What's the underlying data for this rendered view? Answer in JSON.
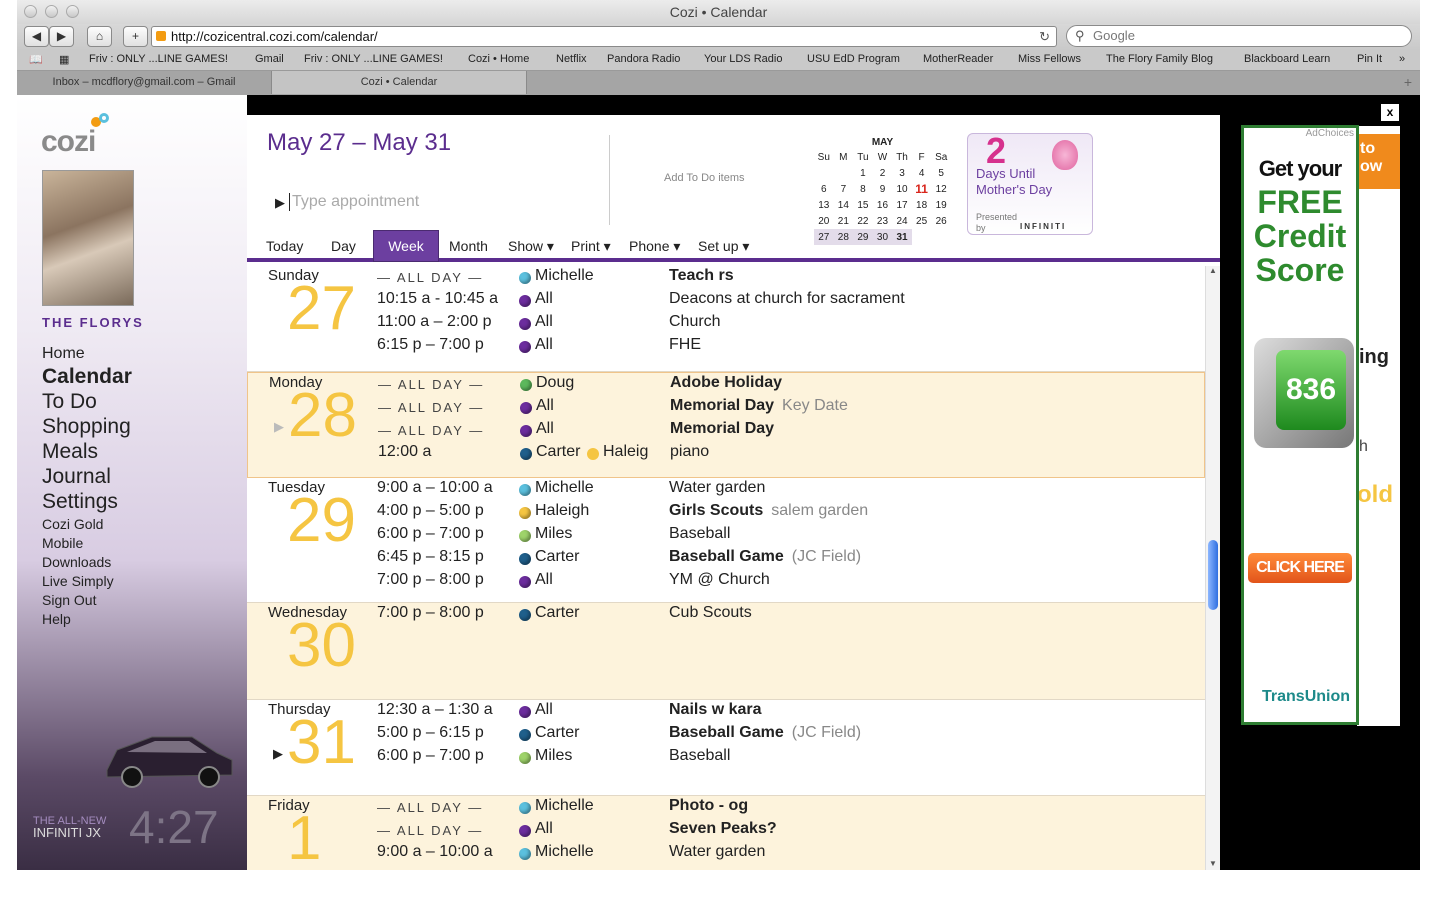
{
  "browser": {
    "title": "Cozi • Calendar",
    "url": "http://cozicentral.cozi.com/calendar/",
    "search_placeholder": "Google",
    "bookmarks": [
      "Friv : ONLY ...LINE GAMES!",
      "Gmail",
      "Friv : ONLY ...LINE GAMES!",
      "Cozi • Home",
      "Netflix",
      "Pandora Radio",
      "Your LDS Radio",
      "USU EdD Program",
      "MotherReader",
      "Miss Fellows",
      "The Flory Family Blog",
      "Blackboard Learn",
      "Pin It"
    ],
    "tabs": [
      "Inbox – mcdflory@gmail.com – Gmail",
      "Cozi • Calendar"
    ]
  },
  "sidebar": {
    "logo": "cozi",
    "family": "THE FLORYS",
    "nav_main": [
      "Home",
      "Calendar",
      "To Do",
      "Shopping",
      "Meals",
      "Journal",
      "Settings"
    ],
    "nav_small": [
      "Cozi Gold",
      "Mobile",
      "Downloads",
      "Live Simply",
      "Sign Out",
      "Help"
    ],
    "ad_line1": "THE ALL-NEW",
    "ad_line2": "INFINITI JX",
    "clock": "4:27"
  },
  "calendar": {
    "range": "May 27 – May 31",
    "appt_placeholder": "Type appointment",
    "todo": "Add To Do items",
    "views": [
      "Today",
      "Day",
      "Week",
      "Month",
      "Show ▾",
      "Print ▾",
      "Phone ▾",
      "Set up ▾"
    ],
    "minical": {
      "month": "MAY",
      "dow": [
        "Su",
        "M",
        "Tu",
        "W",
        "Th",
        "F",
        "Sa"
      ],
      "rows": [
        [
          "",
          "",
          "",
          "1",
          "2",
          "3",
          "4",
          "5"
        ],
        [
          "6",
          "7",
          "8",
          "9",
          "10",
          "11",
          "12"
        ],
        [
          "13",
          "14",
          "15",
          "16",
          "17",
          "18",
          "19"
        ],
        [
          "20",
          "21",
          "22",
          "23",
          "24",
          "25",
          "26"
        ],
        [
          "27",
          "28",
          "29",
          "30",
          "31",
          "",
          ""
        ]
      ]
    },
    "countdown": {
      "number": "2",
      "text": "Days Until Mother's Day",
      "presented": "Presented by",
      "brand": "INFINITI"
    },
    "days": [
      {
        "name": "Sunday",
        "num": "27",
        "events": [
          {
            "time": "— ALL DAY —",
            "allday": true,
            "who": "Michelle",
            "color": "#5bc0de",
            "what": "Teach rs",
            "bold": true
          },
          {
            "time": "10:15 a - 10:45 a",
            "who": "All",
            "color": "#6c2d9e",
            "what": "Deacons at church for sacrament"
          },
          {
            "time": "11:00 a – 2:00 p",
            "who": "All",
            "color": "#6c2d9e",
            "what": "Church"
          },
          {
            "time": "6:15 p – 7:00 p",
            "who": "All",
            "color": "#6c2d9e",
            "what": "FHE"
          }
        ]
      },
      {
        "name": "Monday",
        "num": "28",
        "events": [
          {
            "time": "— ALL DAY —",
            "allday": true,
            "who": "Doug",
            "color": "#5cb85c",
            "what": "Adobe Holiday",
            "bold": true
          },
          {
            "time": "— ALL DAY —",
            "allday": true,
            "who": "All",
            "color": "#6c2d9e",
            "what": "Memorial Day",
            "bold": true,
            "note": "Key Date"
          },
          {
            "time": "— ALL DAY —",
            "allday": true,
            "who": "All",
            "color": "#6c2d9e",
            "what": "Memorial Day",
            "bold": true
          },
          {
            "time": "12:00 a",
            "who": "Carter",
            "color": "#1f5f8b",
            "who2": "Haleig",
            "color2": "#f5c542",
            "what": "piano"
          }
        ]
      },
      {
        "name": "Tuesday",
        "num": "29",
        "events": [
          {
            "time": "9:00 a – 10:00 a",
            "who": "Michelle",
            "color": "#5bc0de",
            "what": "Water garden"
          },
          {
            "time": "4:00 p – 5:00 p",
            "who": "Haleigh",
            "color": "#f5c542",
            "what": "Girls Scouts",
            "bold": true,
            "note": "salem garden"
          },
          {
            "time": "6:00 p – 7:00 p",
            "who": "Miles",
            "color": "#9ed36a",
            "what": "Baseball"
          },
          {
            "time": "6:45 p – 8:15 p",
            "who": "Carter",
            "color": "#1f5f8b",
            "what": "Baseball Game",
            "bold": true,
            "note": "(JC Field)"
          },
          {
            "time": "7:00 p – 8:00 p",
            "who": "All",
            "color": "#6c2d9e",
            "what": "YM @ Church"
          }
        ]
      },
      {
        "name": "Wednesday",
        "num": "30",
        "events": [
          {
            "time": "7:00 p – 8:00 p",
            "who": "Carter",
            "color": "#1f5f8b",
            "what": "Cub Scouts"
          }
        ]
      },
      {
        "name": "Thursday",
        "num": "31",
        "events": [
          {
            "time": "12:30 a – 1:30 a",
            "who": "All",
            "color": "#6c2d9e",
            "what": "Nails w kara",
            "bold": true
          },
          {
            "time": "5:00 p – 6:15 p",
            "who": "Carter",
            "color": "#1f5f8b",
            "what": "Baseball Game",
            "bold": true,
            "note": "(JC Field)"
          },
          {
            "time": "6:00 p – 7:00 p",
            "who": "Miles",
            "color": "#9ed36a",
            "what": "Baseball"
          }
        ]
      },
      {
        "name": "Friday",
        "num": "1",
        "events": [
          {
            "time": "— ALL DAY —",
            "allday": true,
            "who": "Michelle",
            "color": "#5bc0de",
            "what": "Photo - og",
            "bold": true
          },
          {
            "time": "— ALL DAY —",
            "allday": true,
            "who": "All",
            "color": "#6c2d9e",
            "what": "Seven Peaks?",
            "bold": true
          },
          {
            "time": "9:00 a – 10:00 a",
            "who": "Michelle",
            "color": "#5bc0de",
            "what": "Water garden"
          }
        ]
      }
    ]
  },
  "ad": {
    "choices": "AdChoices",
    "line1": "Get your",
    "line2": "FREE",
    "line3": "Credit",
    "line4": "Score",
    "score": "836",
    "cta": "CLICK HERE",
    "brand": "TransUnion",
    "side1": "to",
    "side2": "ow",
    "side3": "ing",
    "side4": "h",
    "side5": "old",
    "close": "x"
  }
}
